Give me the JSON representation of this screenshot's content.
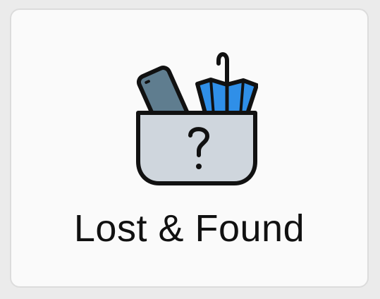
{
  "tile": {
    "label": "Lost & Found",
    "icon": "lost-and-found-box-icon",
    "colors": {
      "background": "#ebebeb",
      "card": "#fafafa",
      "card_border": "#dcdcdc",
      "text": "#111111",
      "box_fill": "#cfd6dd",
      "phone_fill": "#5f7d8f",
      "umbrella_fill": "#2f8fe8",
      "outline": "#111111"
    }
  }
}
